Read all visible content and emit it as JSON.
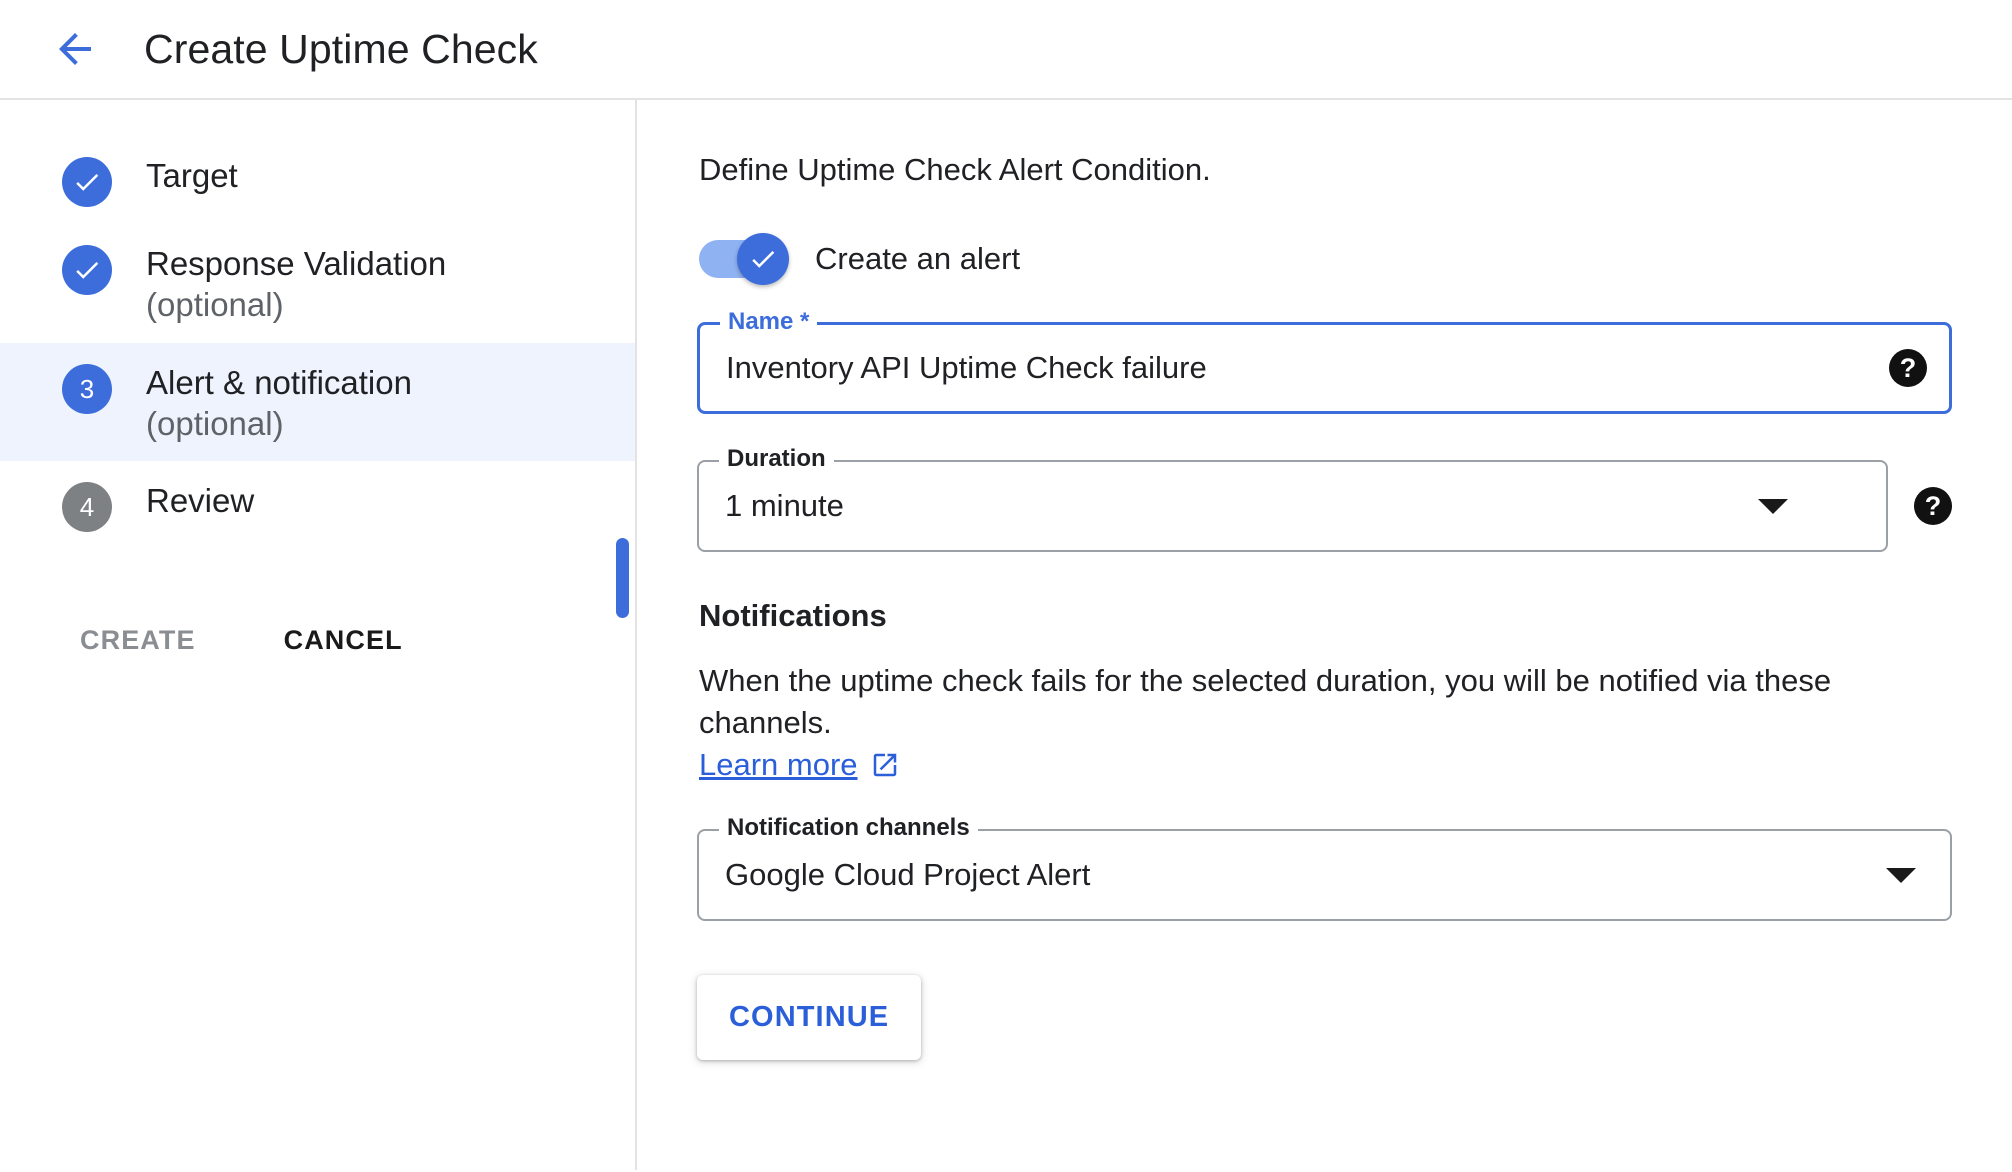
{
  "header": {
    "title": "Create Uptime Check",
    "back_icon": "arrow-back-icon"
  },
  "sidebar": {
    "steps": [
      {
        "marker": "✓",
        "state": "done",
        "label": "Target",
        "sub": ""
      },
      {
        "marker": "✓",
        "state": "done",
        "label": "Response Validation",
        "sub": "(optional)"
      },
      {
        "marker": "3",
        "state": "current",
        "label": "Alert & notification",
        "sub": "(optional)"
      },
      {
        "marker": "4",
        "state": "todo",
        "label": "Review",
        "sub": ""
      }
    ],
    "actions": {
      "create_label": "CREATE",
      "cancel_label": "CANCEL"
    }
  },
  "main": {
    "intro": "Define Uptime Check Alert Condition.",
    "toggle": {
      "label": "Create an alert",
      "state": "on",
      "icon": "check-icon"
    },
    "name_field": {
      "legend": "Name *",
      "value": "Inventory API Uptime Check failure",
      "help_icon": "help-icon",
      "help_glyph": "?",
      "focused": true
    },
    "duration_field": {
      "legend": "Duration",
      "value": "1 minute",
      "dropdown_icon": "chevron-down-icon",
      "help_icon": "help-icon",
      "help_glyph": "?"
    },
    "notifications": {
      "title": "Notifications",
      "description": "When the uptime check fails for the selected duration, you will be notified via these channels.",
      "learn_more_label": "Learn more",
      "learn_more_icon": "open-in-new-icon"
    },
    "channels_field": {
      "legend": "Notification channels",
      "value": "Google Cloud Project Alert",
      "dropdown_icon": "chevron-down-icon"
    },
    "continue_label": "CONTINUE"
  },
  "colors": {
    "accent_blue": "#3c6ddb",
    "link_blue": "#2b5fd9",
    "active_row_bg": "#eef3fd",
    "todo_gray": "#7e8184",
    "divider": "#e3e3e3"
  }
}
